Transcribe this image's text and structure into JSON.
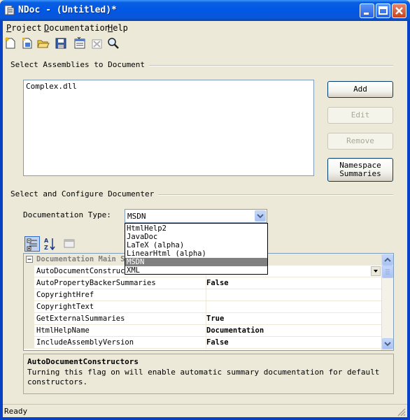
{
  "window": {
    "title": "NDoc - (Untitled)*"
  },
  "menu": {
    "items": [
      {
        "underline": "P",
        "rest": "roject"
      },
      {
        "underline": "D",
        "rest": "ocumentation"
      },
      {
        "underline": "H",
        "rest": "elp"
      }
    ]
  },
  "toolbar": {
    "icons": [
      "new-project-icon",
      "new-from-solution-icon",
      "open-icon",
      "save-icon",
      "build-icon",
      "clean-icon",
      "view-icon"
    ]
  },
  "assemblies": {
    "header": "Select Assemblies to Document",
    "items": [
      "Complex.dll"
    ],
    "buttons": {
      "add": "Add",
      "edit": "Edit",
      "remove": "Remove",
      "namespace_line1": "Namespace",
      "namespace_line2": "Summaries"
    }
  },
  "documenter": {
    "header": "Select and Configure Documenter",
    "type_label": "Documentation Type:",
    "selected_type": "MSDN",
    "options": [
      "HtmlHelp2",
      "JavaDoc",
      "LaTeX (alpha)",
      "LinearHtml (alpha)",
      "MSDN",
      "XML"
    ],
    "highlighted_option": "MSDN"
  },
  "property_grid": {
    "category": "Documentation Main Settings",
    "rows": [
      {
        "name": "AutoDocumentConstructors",
        "value": ""
      },
      {
        "name": "AutoPropertyBackerSummaries",
        "value": "False"
      },
      {
        "name": "CopyrightHref",
        "value": ""
      },
      {
        "name": "CopyrightText",
        "value": ""
      },
      {
        "name": "GetExternalSummaries",
        "value": "True"
      },
      {
        "name": "HtmlHelpName",
        "value": "Documentation"
      },
      {
        "name": "IncludeAssemblyVersion",
        "value": "False"
      }
    ],
    "description_title": "AutoDocumentConstructors",
    "description_line1": "Turning this flag on will enable automatic summary documentation for default",
    "description_line2": "constructors."
  },
  "status": {
    "text": "Ready"
  }
}
